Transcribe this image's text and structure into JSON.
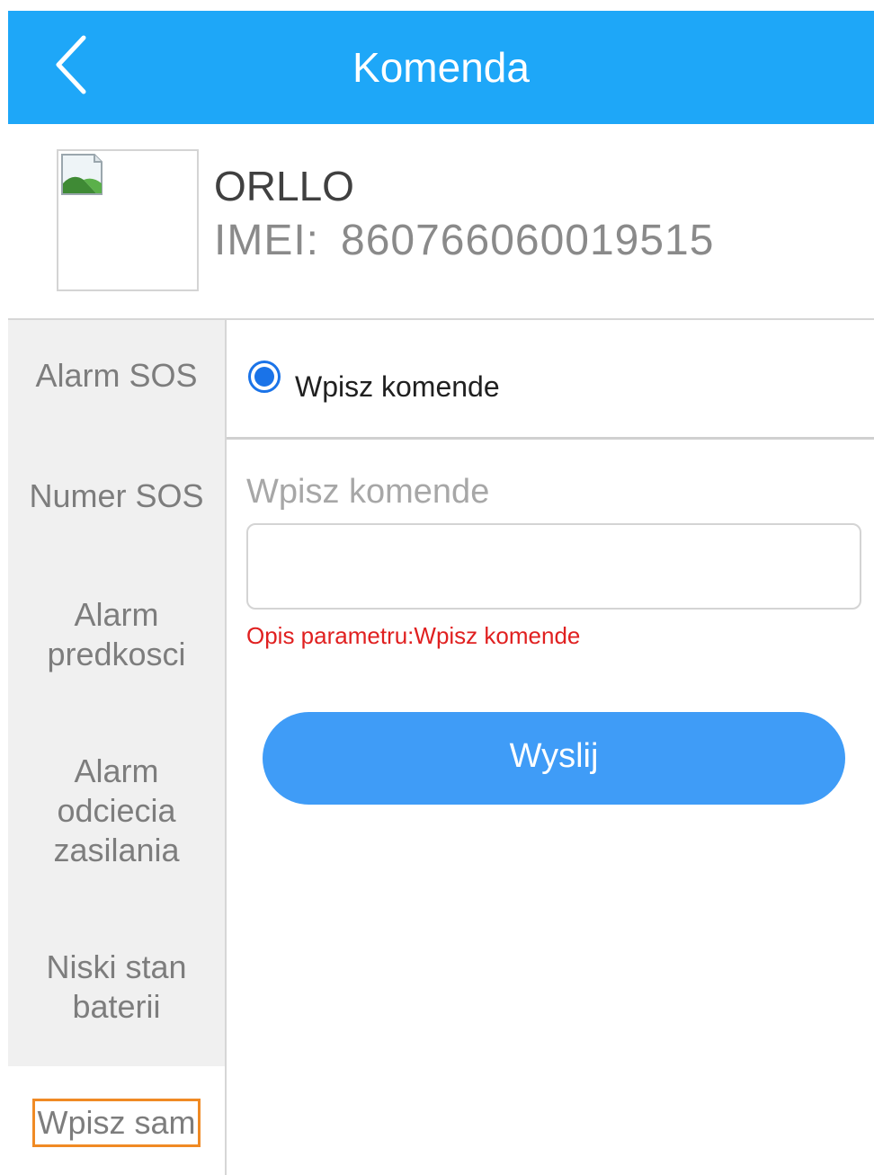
{
  "header": {
    "title": "Komenda",
    "back_icon": "chevron-left-icon"
  },
  "device": {
    "name": "ORLLO",
    "imei_label": "IMEI:",
    "imei_value": "860766060019515",
    "thumbnail_icon": "broken-image-icon"
  },
  "sidebar": {
    "items": [
      {
        "label": "Alarm SOS"
      },
      {
        "label": "Numer SOS"
      },
      {
        "label_lines": [
          "Alarm",
          "predkosci"
        ]
      },
      {
        "label_lines": [
          "Alarm",
          "odciecia",
          "zasilania"
        ]
      },
      {
        "label_lines": [
          "Niski stan",
          "baterii"
        ]
      },
      {
        "label": "Wpisz sam",
        "active": true
      }
    ]
  },
  "main": {
    "radio_option": {
      "label": "Wpisz komende",
      "checked": true
    },
    "field_label": "Wpisz komende",
    "input_value": "",
    "param_description": "Opis parametru:Wpisz komende",
    "send_button": "Wyslij"
  },
  "colors": {
    "header_bg": "#1ea7f8",
    "accent_blue": "#1a73e8",
    "button_bg": "#3f9cf7",
    "error_red": "#e02020",
    "highlight_orange": "#f08a24",
    "sidebar_bg": "#f0f0f0"
  }
}
